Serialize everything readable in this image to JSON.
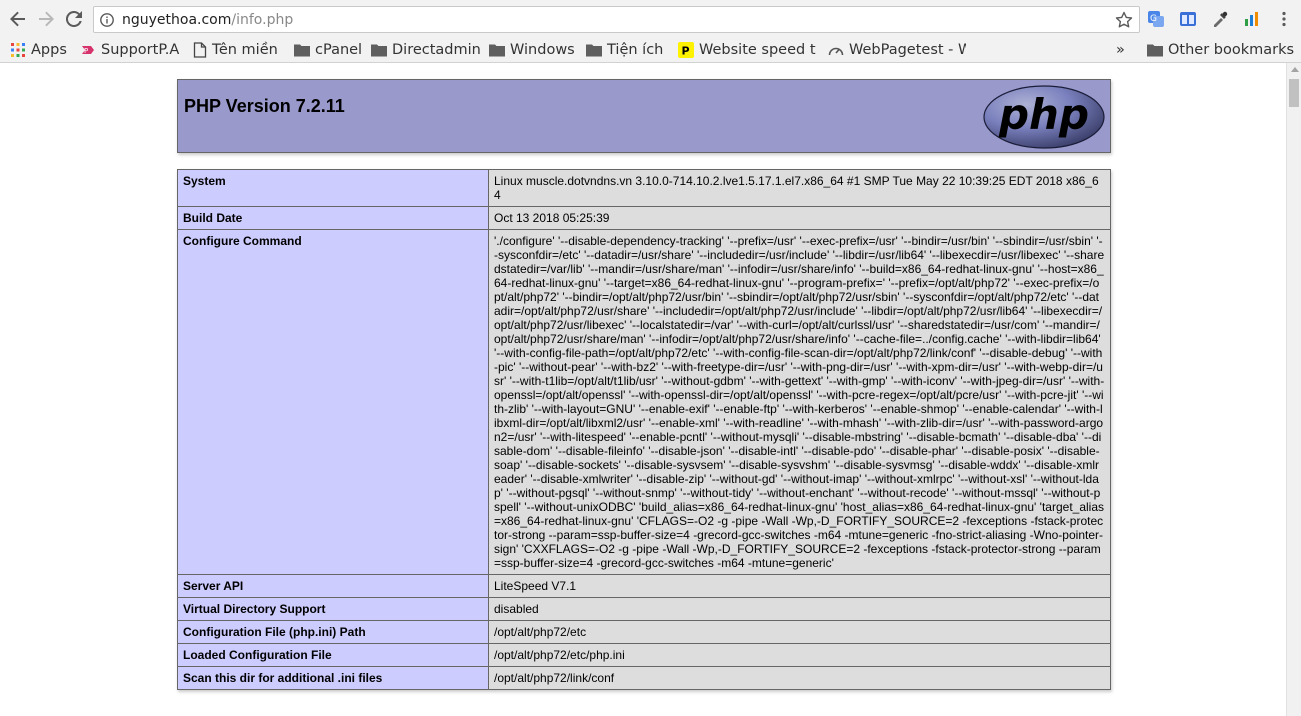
{
  "browser": {
    "url_host": "nguyethoa.com",
    "url_path": "/info.php",
    "bookmarks": [
      {
        "label": "Apps",
        "icon": "apps-grid-icon"
      },
      {
        "label": "SupportP.A",
        "icon": "supportpa-icon"
      },
      {
        "label": "Tên miền",
        "icon": "page-icon"
      },
      {
        "label": "cPanel",
        "icon": "folder-icon"
      },
      {
        "label": "Directadmin",
        "icon": "folder-icon"
      },
      {
        "label": "Windows",
        "icon": "folder-icon"
      },
      {
        "label": "Tiện ích",
        "icon": "folder-icon"
      },
      {
        "label": "Website speed te",
        "icon": "pingdom-icon"
      },
      {
        "label": "WebPagetest - W",
        "icon": "gauge-icon"
      }
    ],
    "overflow": "»",
    "other_bookmarks": "Other bookmarks"
  },
  "phpinfo": {
    "title": "PHP Version 7.2.11",
    "logo_text": "php",
    "rows": [
      {
        "key": "System",
        "value": "Linux muscle.dotvndns.vn 3.10.0-714.10.2.lve1.5.17.1.el7.x86_64 #1 SMP Tue May 22 10:39:25 EDT 2018 x86_64"
      },
      {
        "key": "Build Date",
        "value": "Oct 13 2018 05:25:39"
      },
      {
        "key": "Configure Command",
        "value": "'./configure' '--disable-dependency-tracking' '--prefix=/usr' '--exec-prefix=/usr' '--bindir=/usr/bin' '--sbindir=/usr/sbin' '--sysconfdir=/etc' '--datadir=/usr/share' '--includedir=/usr/include' '--libdir=/usr/lib64' '--libexecdir=/usr/libexec' '--sharedstatedir=/var/lib' '--mandir=/usr/share/man' '--infodir=/usr/share/info' '--build=x86_64-redhat-linux-gnu' '--host=x86_64-redhat-linux-gnu' '--target=x86_64-redhat-linux-gnu' '--program-prefix=' '--prefix=/opt/alt/php72' '--exec-prefix=/opt/alt/php72' '--bindir=/opt/alt/php72/usr/bin' '--sbindir=/opt/alt/php72/usr/sbin' '--sysconfdir=/opt/alt/php72/etc' '--datadir=/opt/alt/php72/usr/share' '--includedir=/opt/alt/php72/usr/include' '--libdir=/opt/alt/php72/usr/lib64' '--libexecdir=/opt/alt/php72/usr/libexec' '--localstatedir=/var' '--with-curl=/opt/alt/curlssl/usr' '--sharedstatedir=/usr/com' '--mandir=/opt/alt/php72/usr/share/man' '--infodir=/opt/alt/php72/usr/share/info' '--cache-file=../config.cache' '--with-libdir=lib64' '--with-config-file-path=/opt/alt/php72/etc' '--with-config-file-scan-dir=/opt/alt/php72/link/conf' '--disable-debug' '--with-pic' '--without-pear' '--with-bz2' '--with-freetype-dir=/usr' '--with-png-dir=/usr' '--with-xpm-dir=/usr' '--with-webp-dir=/usr' '--with-t1lib=/opt/alt/t1lib/usr' '--without-gdbm' '--with-gettext' '--with-gmp' '--with-iconv' '--with-jpeg-dir=/usr' '--with-openssl=/opt/alt/openssl' '--with-openssl-dir=/opt/alt/openssl' '--with-pcre-regex=/opt/alt/pcre/usr' '--with-pcre-jit' '--with-zlib' '--with-layout=GNU' '--enable-exif' '--enable-ftp' '--with-kerberos' '--enable-shmop' '--enable-calendar' '--with-libxml-dir=/opt/alt/libxml2/usr' '--enable-xml' '--with-readline' '--with-mhash' '--with-zlib-dir=/usr' '--with-password-argon2=/usr' '--with-litespeed' '--enable-pcntl' '--without-mysqli' '--disable-mbstring' '--disable-bcmath' '--disable-dba' '--disable-dom' '--disable-fileinfo' '--disable-json' '--disable-intl' '--disable-pdo' '--disable-phar' '--disable-posix' '--disable-soap' '--disable-sockets' '--disable-sysvsem' '--disable-sysvshm' '--disable-sysvmsg' '--disable-wddx' '--disable-xmlreader' '--disable-xmlwriter' '--disable-zip' '--without-gd' '--without-imap' '--without-xmlrpc' '--without-xsl' '--without-ldap' '--without-pgsql' '--without-snmp' '--without-tidy' '--without-enchant' '--without-recode' '--without-mssql' '--without-pspell' '--without-unixODBC' 'build_alias=x86_64-redhat-linux-gnu' 'host_alias=x86_64-redhat-linux-gnu' 'target_alias=x86_64-redhat-linux-gnu' 'CFLAGS=-O2 -g -pipe -Wall -Wp,-D_FORTIFY_SOURCE=2 -fexceptions -fstack-protector-strong --param=ssp-buffer-size=4 -grecord-gcc-switches -m64 -mtune=generic -fno-strict-aliasing -Wno-pointer-sign' 'CXXFLAGS=-O2 -g -pipe -Wall -Wp,-D_FORTIFY_SOURCE=2 -fexceptions -fstack-protector-strong --param=ssp-buffer-size=4 -grecord-gcc-switches -m64 -mtune=generic'"
      },
      {
        "key": "Server API",
        "value": "LiteSpeed V7.1"
      },
      {
        "key": "Virtual Directory Support",
        "value": "disabled"
      },
      {
        "key": "Configuration File (php.ini) Path",
        "value": "/opt/alt/php72/etc"
      },
      {
        "key": "Loaded Configuration File",
        "value": "/opt/alt/php72/etc/php.ini"
      },
      {
        "key": "Scan this dir for additional .ini files",
        "value": "/opt/alt/php72/link/conf"
      }
    ]
  }
}
